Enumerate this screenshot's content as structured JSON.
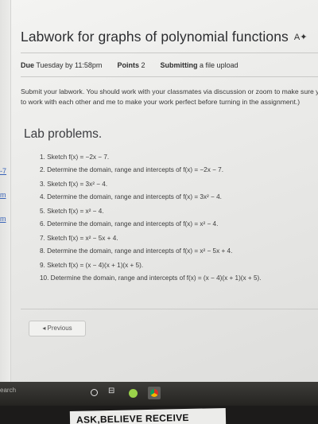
{
  "assignment": {
    "title": "Labwork for graphs of polynomial functions",
    "due_label": "Due",
    "due_value": "Tuesday by 11:58pm",
    "points_label": "Points",
    "points_value": "2",
    "submitting_label": "Submitting",
    "submitting_value": "a file upload",
    "description_line1": "Submit your labwork.  You should work with your classmates via discussion or zoom to make sure y",
    "description_line2": "to work with each other and me to make your work perfect before turning in the assignment.)"
  },
  "lab": {
    "heading": "Lab problems.",
    "problems": [
      "1. Sketch f(x) = −2x − 7.",
      "2. Determine the domain, range and intercepts of f(x) = −2x − 7.",
      "3. Sketch f(x) = 3x² − 4.",
      "4. Determine the domain, range and intercepts of f(x) = 3x² − 4.",
      "5. Sketch f(x) = x² − 4.",
      "6. Determine the domain, range and intercepts of f(x) = x² − 4.",
      "7. Sketch f(x) = x² − 5x + 4.",
      "8. Determine the domain, range and intercepts of f(x) = x² − 5x + 4.",
      "9. Sketch f(x) = (x − 4)(x + 1)(x + 5).",
      "10. Determine the domain, range and intercepts of f(x) = (x − 4)(x + 1)(x + 5)."
    ]
  },
  "nav": {
    "previous_label": "◂ Previous"
  },
  "left_edge": {
    "link1": "-7",
    "link2": "m",
    "link3": "m"
  },
  "taskbar": {
    "search_text": "earch"
  },
  "sticker": {
    "text": "ASK,BELIEVE RECEIVE"
  }
}
